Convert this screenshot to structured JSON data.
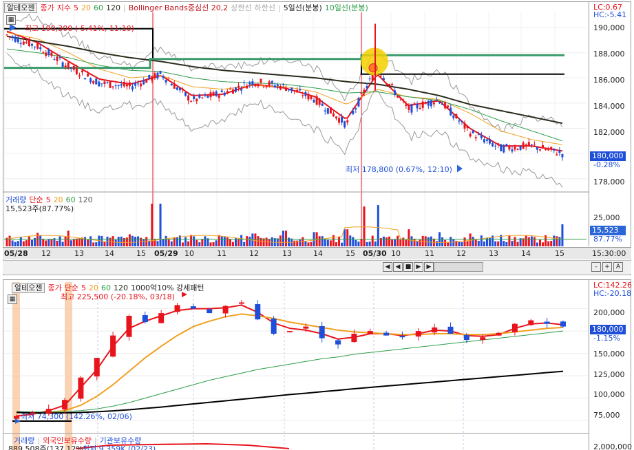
{
  "colors": {
    "rise": "#e8141c",
    "fall": "#1f4fd8",
    "ma5": "#e8141c",
    "ma20": "#f0a020",
    "ma60": "#2e9d4a",
    "ma120": "#2b2b1c",
    "boll": "#9a9a9a",
    "flag": "#2a66d8",
    "accent_green": "#3a9a6a",
    "highlight": "#f5d000"
  },
  "top": {
    "tab": "알테오젠",
    "legend": {
      "price_label": "종가",
      "ma_type": "지수",
      "p5": "5",
      "p20": "20",
      "p60": "60",
      "p120": "120",
      "boll": "Bollinger Bands중심선 20,2",
      "upper": "상한선",
      "lower": "하한선",
      "line5": "5일선(분봉)",
      "line10": "10일선(분봉)"
    },
    "lc": "LC:0.67",
    "hc": "HC:-5.41",
    "high_note": "최고 190,300 (-5.41%, 11:10)",
    "low_note": "최저 178,800 (0.67%, 12:10)",
    "yticks": [
      "190,000",
      "188,000",
      "186,000",
      "184,000",
      "182,000",
      "180,000",
      "178,000"
    ],
    "cur_price": "180,000",
    "cur_pct": "-0.28%",
    "vol_legend": {
      "label": "거래량",
      "ma_type": "단순",
      "p5": "5",
      "p20": "20",
      "p60": "60",
      "p120": "120"
    },
    "vol_value": "15,523주(87.77%)",
    "vol_ticks": [
      "25,000",
      "5,000"
    ],
    "vol_badge": "15,523",
    "vol_pct": "87.77%",
    "xticks": [
      "05/28",
      "12",
      "13",
      "14",
      "15",
      "05/29",
      "10",
      "11",
      "12",
      "13",
      "14",
      "15",
      "05/30",
      "10",
      "11",
      "12",
      "13",
      "14",
      "15"
    ],
    "time_label": "15:30:00",
    "buttons": [
      "◀",
      "◀",
      "■",
      "▶",
      "▶",
      "-",
      "+",
      "A"
    ]
  },
  "bottom": {
    "tab": "알테오젠",
    "legend": {
      "price_label": "종가",
      "ma_type": "단순",
      "p5": "5",
      "p20": "20",
      "p60": "60",
      "p120": "120",
      "extra": "1000억10% 강세패턴"
    },
    "lc": "LC:142.26",
    "hc": "HC:-20.18",
    "high_note": "최고 225,500 (-20.18%, 03/18)",
    "low_note": "최저 74,300 (142.26%, 02/06)",
    "yticks": [
      "200,000",
      "175,000",
      "150,000",
      "125,000",
      "100,000",
      "75,000"
    ],
    "cur_price": "180,000",
    "cur_pct": "-1.15%",
    "vol_legend": {
      "label": "거래량",
      "foreign": "외국인보유수량",
      "inst": "기관보유수량"
    },
    "vol_value": "889,508주(137.12%)",
    "vol_note": "최저 9,359K (02/23)",
    "vol_tick": "2,000,000"
  },
  "chart_data": [
    {
      "type": "candlestick",
      "title": "",
      "ylim": [
        177000,
        191200
      ],
      "x": [
        "05/28",
        "12",
        "13",
        "14",
        "15",
        "05/29",
        "10",
        "11",
        "12",
        "13",
        "14",
        "15",
        "05/30",
        "10",
        "11",
        "12",
        "13",
        "14",
        "15"
      ],
      "series": [
        {
          "name": "종가",
          "values": [
            189400,
            188500,
            186900,
            185600,
            185300,
            186300,
            184200,
            184800,
            185700,
            185300,
            184300,
            182300,
            186800,
            183500,
            184300,
            181700,
            180400,
            180600,
            180000
          ]
        },
        {
          "name": "5",
          "values": [
            189700,
            188800,
            187300,
            185900,
            185500,
            186200,
            184600,
            184700,
            185500,
            185200,
            184500,
            182700,
            186300,
            183800,
            184200,
            182000,
            180600,
            180600,
            180200
          ]
        },
        {
          "name": "20",
          "values": [
            189600,
            189100,
            188000,
            186700,
            186000,
            186200,
            185300,
            185100,
            185400,
            185300,
            184900,
            183900,
            185100,
            184500,
            184300,
            183200,
            181800,
            181100,
            180700
          ]
        },
        {
          "name": "60",
          "values": [
            188300,
            188000,
            187600,
            187000,
            186600,
            186500,
            186000,
            185700,
            185600,
            185500,
            185200,
            184800,
            184900,
            184500,
            184200,
            183500,
            182600,
            181800,
            181000
          ]
        },
        {
          "name": "120",
          "values": [
            189300,
            188900,
            188500,
            188000,
            187600,
            187300,
            186900,
            186600,
            186400,
            186200,
            186000,
            185700,
            185500,
            185100,
            184600,
            183900,
            183400,
            182900,
            182400
          ]
        }
      ],
      "volume": {
        "title": "",
        "values": [
          6000,
          9500,
          11000,
          7500,
          8500,
          30000,
          8000,
          7000,
          9000,
          11000,
          10000,
          12000,
          29000,
          12000,
          10000,
          9000,
          8000,
          7000,
          15523
        ],
        "ticks": [
          25000,
          5000
        ]
      },
      "lines": {
        "black": [
          {
            "y": 189900,
            "to": "05/29"
          },
          {
            "y": 187500,
            "from": "05/29",
            "to": "05/30"
          },
          {
            "y": 186300,
            "from": "05/30"
          }
        ],
        "green": [
          {
            "y": 186800,
            "to": "05/29"
          },
          {
            "y": 187500,
            "from": "05/29",
            "to": "05/30"
          },
          {
            "y": 187800,
            "from": "05/30"
          }
        ]
      }
    },
    {
      "type": "candlestick",
      "title": "",
      "ylim": [
        62000,
        222000
      ],
      "x": [
        "02/06",
        "03/18"
      ],
      "series": [
        {
          "name": "종가",
          "values": [
            80000,
            84000,
            88000,
            98000,
            123000,
            145000,
            170000,
            192000,
            185000,
            195000,
            204000,
            200000,
            195000,
            203000,
            207000,
            188000,
            172000,
            175000,
            180000,
            167000,
            160000,
            172000,
            175000,
            170000,
            168000,
            175000,
            179000,
            172000,
            165000,
            168000,
            173000,
            183000,
            187000,
            183000,
            180000
          ]
        },
        {
          "name": "5",
          "values": [
            80000,
            82000,
            86000,
            92000,
            112000,
            132000,
            158000,
            178000,
            186000,
            192000,
            198000,
            200000,
            200000,
            201000,
            204000,
            196000,
            184000,
            178000,
            176000,
            172000,
            166000,
            168000,
            172000,
            172000,
            170000,
            172000,
            176000,
            175000,
            170000,
            169000,
            171000,
            178000,
            183000,
            184000,
            182000
          ]
        },
        {
          "name": "20",
          "values": [
            84000,
            83000,
            84000,
            86000,
            92000,
            102000,
            115000,
            130000,
            145000,
            158000,
            170000,
            180000,
            186000,
            191000,
            194000,
            192000,
            189000,
            185000,
            182000,
            179000,
            176000,
            174000,
            173000,
            172000,
            171000,
            171000,
            172000,
            172000,
            171000,
            171000,
            172000,
            174000,
            176000,
            178000,
            179000
          ]
        },
        {
          "name": "60",
          "values": [
            85000,
            84500,
            84500,
            85000,
            86000,
            88000,
            91000,
            95000,
            100000,
            105000,
            110000,
            115000,
            120000,
            124000,
            128000,
            132000,
            135000,
            138000,
            141000,
            144000,
            146000,
            149000,
            151000,
            153000,
            155000,
            157000,
            159000,
            161000,
            163000,
            165000,
            167000,
            169000,
            171000,
            173000,
            175000
          ]
        },
        {
          "name": "120",
          "values": [
            84000,
            83500,
            83200,
            83500,
            84000,
            84800,
            85800,
            87000,
            88500,
            90000,
            91800,
            93500,
            95200,
            97000,
            98800,
            100500,
            102200,
            104000,
            105500,
            107200,
            108800,
            110500,
            112000,
            113500,
            115000,
            116500,
            118000,
            119500,
            121000,
            122500,
            124000,
            125500,
            127000,
            128500,
            130000
          ]
        }
      ]
    }
  ]
}
